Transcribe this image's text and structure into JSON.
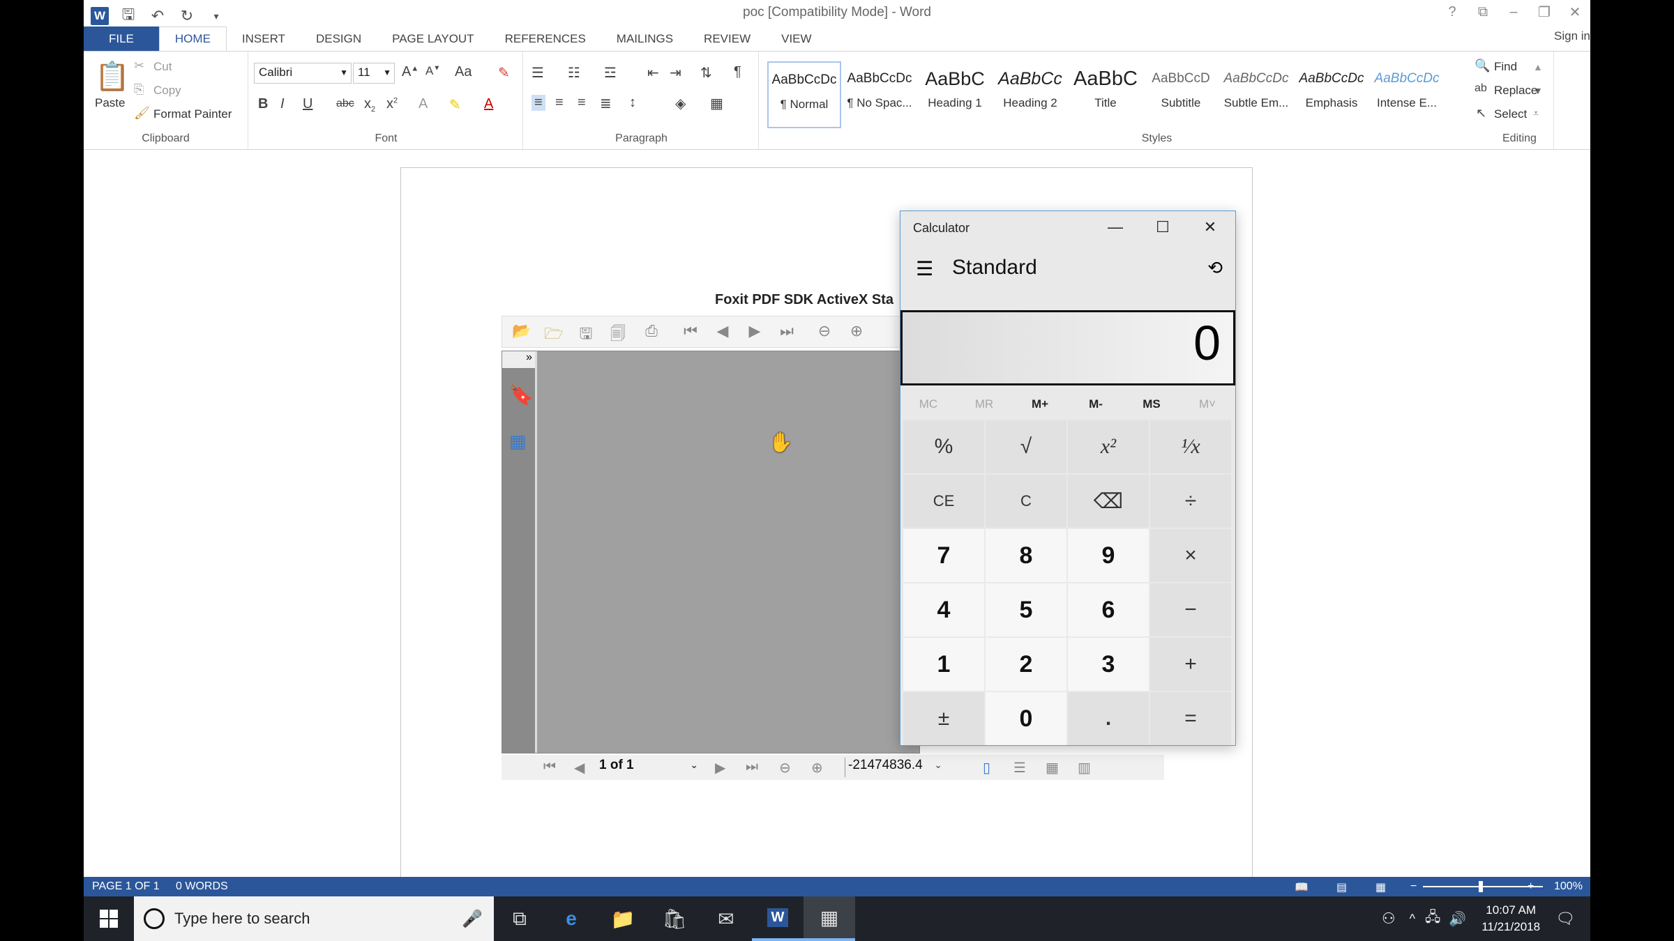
{
  "word": {
    "title": "poc [Compatibility Mode] - Word",
    "tabs": [
      "FILE",
      "HOME",
      "INSERT",
      "DESIGN",
      "PAGE LAYOUT",
      "REFERENCES",
      "MAILINGS",
      "REVIEW",
      "VIEW"
    ],
    "active_tab": "HOME",
    "sign_in": "Sign in",
    "clipboard": {
      "paste": "Paste",
      "cut": "Cut",
      "copy": "Copy",
      "format_painter": "Format Painter",
      "label": "Clipboard"
    },
    "font": {
      "name": "Calibri",
      "size": "11",
      "label": "Font",
      "case": "Aa"
    },
    "paragraph_label": "Paragraph",
    "styles": {
      "label": "Styles",
      "items": [
        {
          "sample": "AaBbCcDc",
          "name": "¶ Normal"
        },
        {
          "sample": "AaBbCcDc",
          "name": "¶ No Spac..."
        },
        {
          "sample": "AaBbC",
          "name": "Heading 1"
        },
        {
          "sample": "AaBbCc",
          "name": "Heading 2"
        },
        {
          "sample": "AaBbC",
          "name": "Title"
        },
        {
          "sample": "AaBbCcD",
          "name": "Subtitle"
        },
        {
          "sample": "AaBbCcDc",
          "name": "Subtle Em..."
        },
        {
          "sample": "AaBbCcDc",
          "name": "Emphasis"
        },
        {
          "sample": "AaBbCcDc",
          "name": "Intense E..."
        }
      ]
    },
    "editing": {
      "find": "Find",
      "replace": "Replace",
      "select": "Select",
      "label": "Editing"
    },
    "status": {
      "page": "PAGE 1 OF 1",
      "words": "0 WORDS",
      "zoom": "100%"
    }
  },
  "foxit": {
    "title": "Foxit PDF SDK ActiveX Sta",
    "page_indicator": "1 of 1",
    "zoom_value": "-21474836.4"
  },
  "calculator": {
    "title": "Calculator",
    "mode": "Standard",
    "display": "0",
    "memory": [
      "MC",
      "MR",
      "M+",
      "M-",
      "MS",
      "M˅"
    ],
    "keys": [
      [
        "%",
        "√",
        "x²",
        "¹⁄x"
      ],
      [
        "CE",
        "C",
        "⌫",
        "÷"
      ],
      [
        "7",
        "8",
        "9",
        "×"
      ],
      [
        "4",
        "5",
        "6",
        "−"
      ],
      [
        "1",
        "2",
        "3",
        "+"
      ],
      [
        "±",
        "0",
        ".",
        "="
      ]
    ]
  },
  "taskbar": {
    "search_placeholder": "Type here to search",
    "time": "10:07 AM",
    "date": "11/21/2018"
  }
}
